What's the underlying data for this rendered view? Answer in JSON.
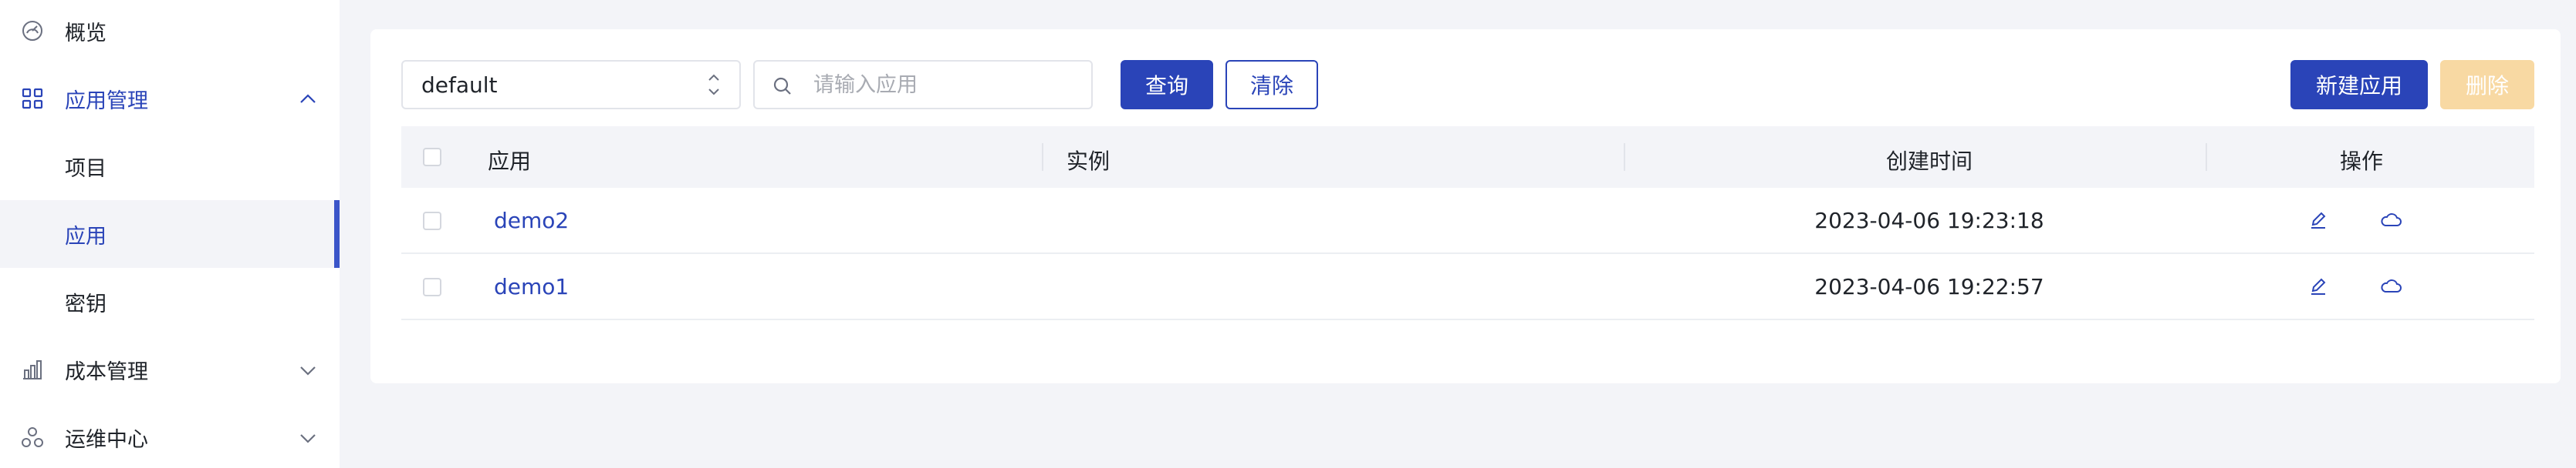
{
  "sidebar": {
    "items": [
      {
        "label": "概览",
        "icon": "dashboard-icon"
      },
      {
        "label": "应用管理",
        "icon": "grid-icon",
        "expanded": true
      },
      {
        "label": "项目"
      },
      {
        "label": "应用",
        "active": true
      },
      {
        "label": "密钥"
      },
      {
        "label": "成本管理",
        "icon": "bar-chart-icon",
        "expanded": false
      },
      {
        "label": "运维中心",
        "icon": "cluster-icon",
        "expanded": false
      }
    ]
  },
  "toolbar": {
    "namespace_value": "default",
    "search_placeholder": "请输入应用",
    "query_label": "查询",
    "clear_label": "清除",
    "new_app_label": "新建应用",
    "delete_label": "删除"
  },
  "table": {
    "headers": {
      "app": "应用",
      "instance": "实例",
      "created_time": "创建时间",
      "actions": "操作"
    },
    "rows": [
      {
        "app": "demo2",
        "instance": "",
        "created_time": "2023-04-06 19:23:18"
      },
      {
        "app": "demo1",
        "instance": "",
        "created_time": "2023-04-06 19:22:57"
      }
    ]
  },
  "colors": {
    "accent": "#2a44b8",
    "active_bar": "#3b55c9",
    "disabled_button": "#f8d9a3",
    "background": "#f3f4f8"
  }
}
